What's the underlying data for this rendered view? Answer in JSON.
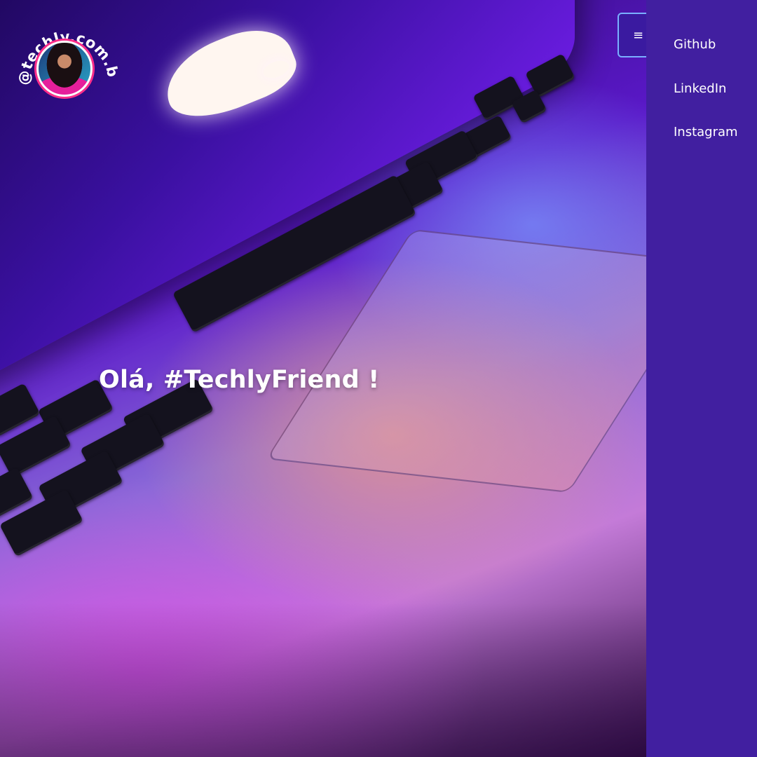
{
  "brand": {
    "handle": "@techly.com.br",
    "avatar_icon": "profile-photo"
  },
  "hero": {
    "greeting": "Olá, #TechlyFriend !"
  },
  "menu": {
    "toggle_icon": "hamburger-icon",
    "toggle_glyph": "≡",
    "items": [
      {
        "label": "Github"
      },
      {
        "label": "LinkedIn"
      },
      {
        "label": "Instagram"
      }
    ]
  },
  "colors": {
    "sidebar": "#411fa0",
    "toggle_border": "#7ab0ff",
    "text": "#ffffff"
  }
}
